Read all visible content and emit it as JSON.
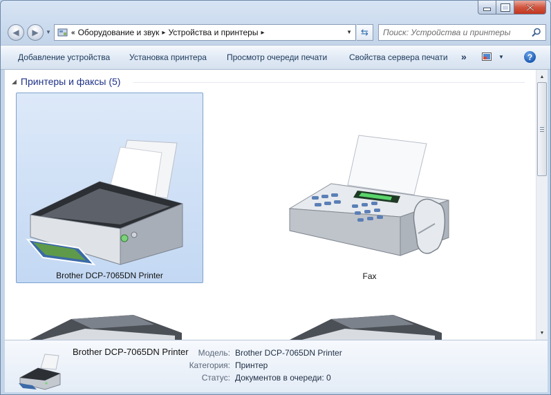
{
  "window": {
    "caption_buttons": [
      "minimize-icon",
      "maximize-icon",
      "close-icon"
    ]
  },
  "nav": {
    "back_icon": "back-arrow-icon",
    "forward_icon": "forward-arrow-icon",
    "breadcrumb_overflow": "«",
    "breadcrumbs": [
      "Оборудование и звук",
      "Устройства и принтеры"
    ],
    "search_placeholder": "Поиск: Устройства и принтеры"
  },
  "commands": {
    "add_device": "Добавление устройства",
    "add_printer": "Установка принтера",
    "view_queue": "Просмотр очереди печати",
    "server_props": "Свойства сервера печати",
    "more": "»",
    "help": "?"
  },
  "group": {
    "title": "Принтеры и факсы (5)"
  },
  "devices": [
    {
      "name": "Brother DCP-7065DN Printer",
      "icon": "printer-icon",
      "selected": true
    },
    {
      "name": "Fax",
      "icon": "fax-icon",
      "selected": false
    }
  ],
  "details": {
    "name": "Brother DCP-7065DN Printer",
    "model_label": "Модель:",
    "model_value": "Brother DCP-7065DN Printer",
    "category_label": "Категория:",
    "category_value": "Принтер",
    "status_label": "Статус:",
    "status_value": "Документов в очереди: 0"
  },
  "colors": {
    "selection": "#cfe0f6",
    "selection_border": "#7da2ce",
    "group_title": "#1e3287",
    "command_text": "#1e395b",
    "close_button": "#c9452e"
  }
}
